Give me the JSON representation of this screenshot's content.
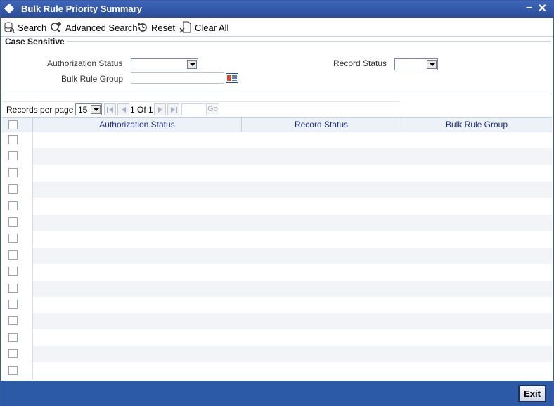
{
  "window": {
    "title": "Bulk Rule Priority Summary",
    "minimize": "–",
    "close": "✕"
  },
  "toolbar": {
    "search_label": "Search",
    "advanced_search_label": "Advanced Search",
    "reset_label": "Reset",
    "clear_all_label": "Clear All"
  },
  "criteria": {
    "section_label": "Case Sensitive",
    "authorization_status_label": "Authorization Status",
    "authorization_status_value": "",
    "record_status_label": "Record Status",
    "record_status_value": "",
    "bulk_rule_group_label": "Bulk Rule Group",
    "bulk_rule_group_value": ""
  },
  "pager": {
    "records_per_page_label": "Records per page",
    "records_per_page_value": "15",
    "page_indicator": "1 Of 1",
    "go_label": "Go"
  },
  "grid": {
    "columns": [
      "Authorization Status",
      "Record Status",
      "Bulk Rule Group"
    ],
    "row_count": 15
  },
  "footer": {
    "exit_label": "Exit"
  },
  "colors": {
    "title_bar": "#2d5aa6",
    "header_text": "#1f2f8c",
    "footer": "#2d5aa6"
  }
}
